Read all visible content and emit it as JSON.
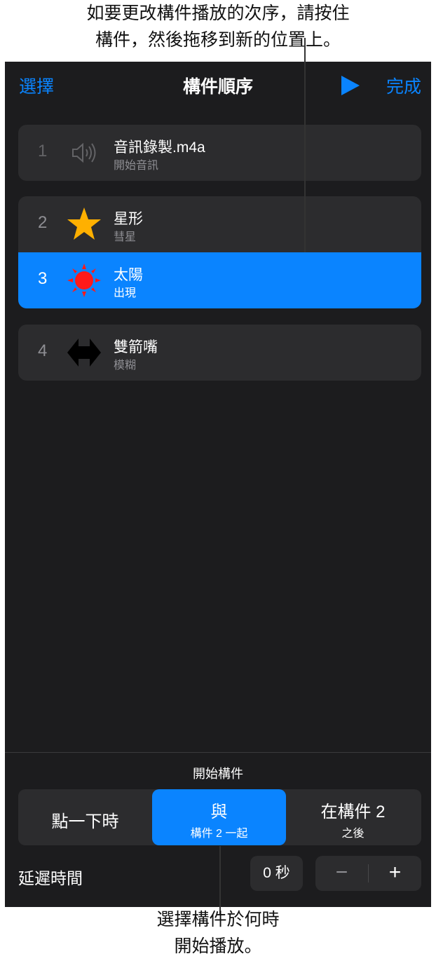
{
  "callouts": {
    "top_line1": "如要更改構件播放的次序，請按住",
    "top_line2": "構件，然後拖移到新的位置上。",
    "bottom_line1": "選擇構件於何時",
    "bottom_line2": "開始播放。"
  },
  "navbar": {
    "select_label": "選擇",
    "title": "構件順序",
    "play_icon": "play-icon",
    "done_label": "完成",
    "accent_color": "#0a84ff"
  },
  "builds": [
    {
      "number": "1",
      "title": "音訊錄製.m4a",
      "subtitle": "開始音訊",
      "icon": "speaker-icon"
    },
    {
      "number": "2",
      "title": "星形",
      "subtitle": "彗星",
      "icon": "star-icon"
    },
    {
      "number": "3",
      "title": "太陽",
      "subtitle": "出現",
      "icon": "sun-icon",
      "selected": true
    },
    {
      "number": "4",
      "title": "雙箭嘴",
      "subtitle": "模糊",
      "icon": "double-arrow-icon"
    }
  ],
  "start_build": {
    "label": "開始構件",
    "options": [
      {
        "main": "點一下時",
        "sub": ""
      },
      {
        "main": "與",
        "sub": "構件 2 一起",
        "selected": true
      },
      {
        "main": "在構件 2",
        "sub": "之後"
      }
    ]
  },
  "delay": {
    "label": "延遲時間",
    "value": "0 秒",
    "minus": "−",
    "plus": "+"
  }
}
